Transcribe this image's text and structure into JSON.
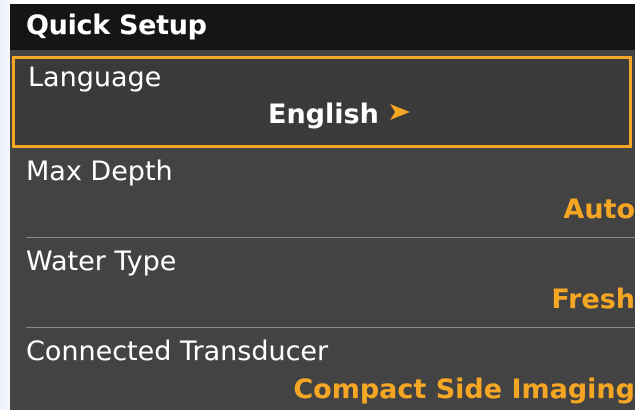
{
  "menu": {
    "title": "Quick Setup",
    "items": [
      {
        "label": "Language",
        "value": "English",
        "selected": true
      },
      {
        "label": "Max Depth",
        "value": "Auto",
        "selected": false
      },
      {
        "label": "Water Type",
        "value": "Fresh",
        "selected": false
      },
      {
        "label": "Connected Transducer",
        "value": "Compact Side Imaging",
        "selected": false
      }
    ]
  },
  "colors": {
    "accent": "#f5a623",
    "panel": "#434343",
    "titlebar": "#151515",
    "text": "#ffffff"
  },
  "icons": {
    "submenu_arrow": "chevron-right-icon"
  }
}
